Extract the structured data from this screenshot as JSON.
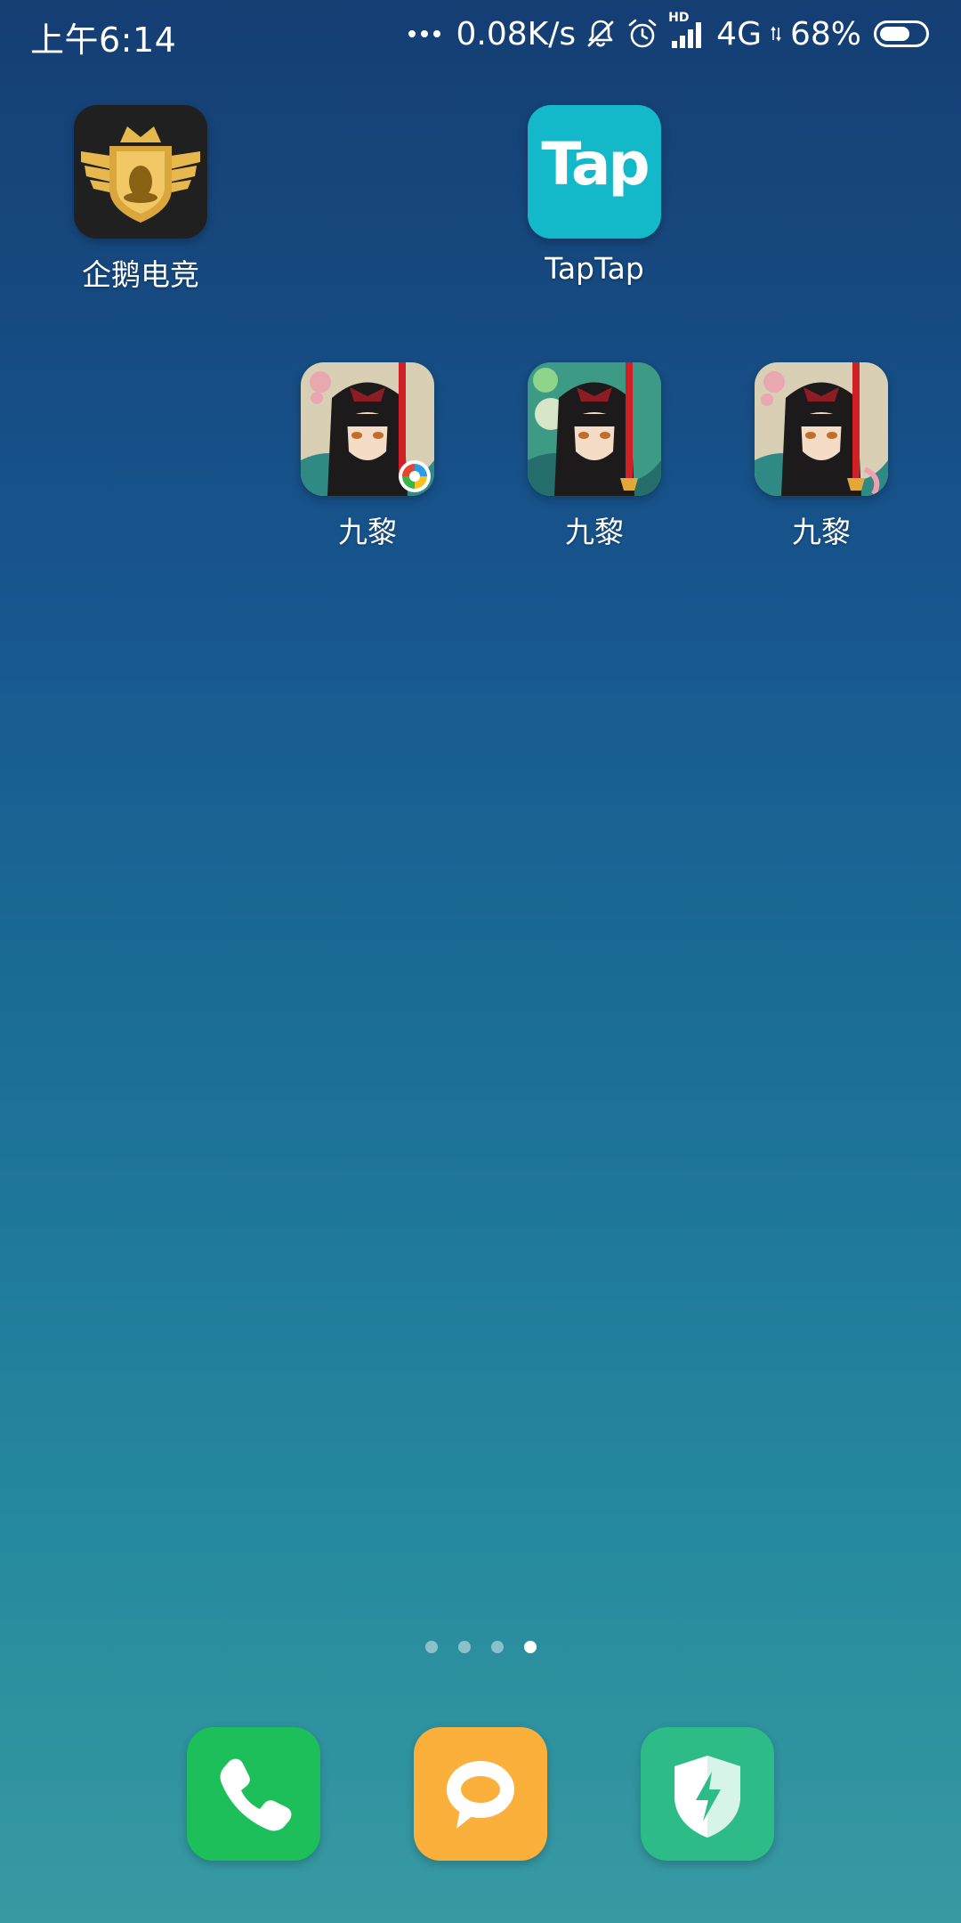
{
  "status_bar": {
    "time": "上午6:14",
    "network_speed": "0.08K/s",
    "hd_label": "HD",
    "network_type": "4G",
    "battery_percent": "68%",
    "battery_level": 0.68,
    "icons": [
      "more-dots-icon",
      "silent-bell-icon",
      "alarm-clock-icon",
      "signal-bars-icon",
      "battery-icon"
    ]
  },
  "home_apps": [
    {
      "label": "企鹅电竞",
      "icon": "penguin-esports-icon"
    },
    {
      "label": "TapTap",
      "icon": "taptap-icon",
      "icon_text": "Tap"
    },
    {
      "label": "九黎",
      "icon": "jiuli-game-icon"
    },
    {
      "label": "九黎",
      "icon": "jiuli-game-icon"
    },
    {
      "label": "九黎",
      "icon": "jiuli-game-icon"
    }
  ],
  "page_indicator": {
    "total": 4,
    "current": 4
  },
  "dock": [
    {
      "icon": "phone-icon",
      "color": "#1dbf5b"
    },
    {
      "icon": "messages-icon",
      "color": "#fbb03b"
    },
    {
      "icon": "security-shield-icon",
      "color": "#2dbb88"
    }
  ],
  "colors": {
    "taptap": "#13b9c9",
    "penguin_bg": "#1e1e1e",
    "penguin_gold": "#e7b94c"
  }
}
